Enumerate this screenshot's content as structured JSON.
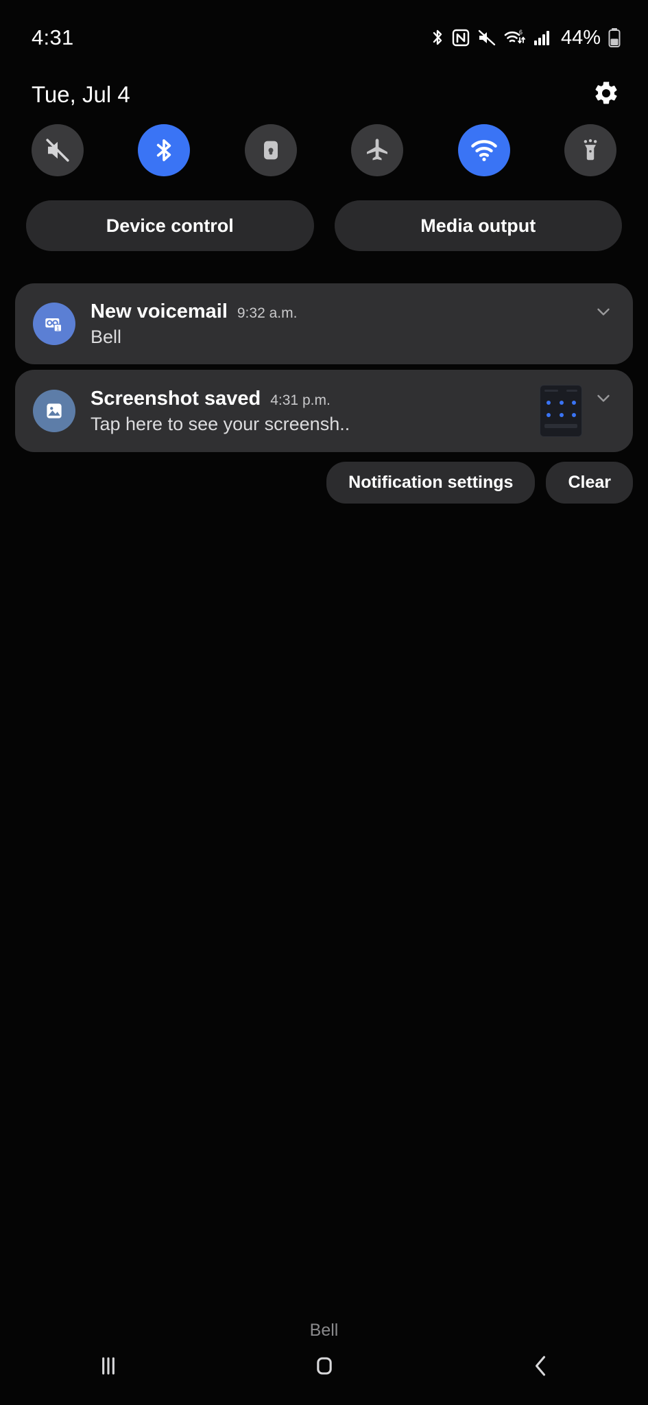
{
  "status_bar": {
    "clock": "4:31",
    "battery_percent": "44%",
    "icons": [
      {
        "name": "bluetooth-icon",
        "label": "Bluetooth"
      },
      {
        "name": "nfc-icon",
        "label": "NFC"
      },
      {
        "name": "mute-icon",
        "label": "Sound off"
      },
      {
        "name": "wifi-6-icon",
        "label": "Wi-Fi 6"
      },
      {
        "name": "cellular-signal-icon",
        "label": "Mobile signal"
      },
      {
        "name": "battery-icon",
        "label": "Battery"
      }
    ]
  },
  "header": {
    "date": "Tue, Jul 4",
    "settings_icon": "gear-icon"
  },
  "quick_settings": {
    "toggles": [
      {
        "name": "sound-toggle",
        "icon": "mute-icon",
        "label": "Sound",
        "active": false
      },
      {
        "name": "bluetooth-toggle",
        "icon": "bluetooth-icon",
        "label": "Bluetooth",
        "active": true
      },
      {
        "name": "auto-rotate-toggle",
        "icon": "rotation-lock-icon",
        "label": "Auto rotate",
        "active": false
      },
      {
        "name": "airplane-mode-toggle",
        "icon": "airplane-icon",
        "label": "Airplane mode",
        "active": false
      },
      {
        "name": "wifi-toggle",
        "icon": "wifi-icon",
        "label": "Wi-Fi",
        "active": true
      },
      {
        "name": "flashlight-toggle",
        "icon": "flashlight-icon",
        "label": "Flashlight",
        "active": false
      }
    ],
    "active_color": "#3a74f5",
    "inactive_color": "#3a3a3c"
  },
  "shortcuts": {
    "device_control": "Device control",
    "media_output": "Media output"
  },
  "notifications": [
    {
      "icon": "voicemail-icon",
      "title": "New voicemail",
      "time": "9:32 a.m.",
      "text": "Bell",
      "has_thumbnail": false
    },
    {
      "icon": "image-icon",
      "title": "Screenshot saved",
      "time": "4:31 p.m.",
      "text": "Tap here to see your screensh..",
      "has_thumbnail": true
    }
  ],
  "notification_actions": {
    "settings": "Notification settings",
    "clear": "Clear"
  },
  "carrier": "Bell",
  "navigation": {
    "recents": "recents-icon",
    "home": "home-icon",
    "back": "back-icon"
  }
}
